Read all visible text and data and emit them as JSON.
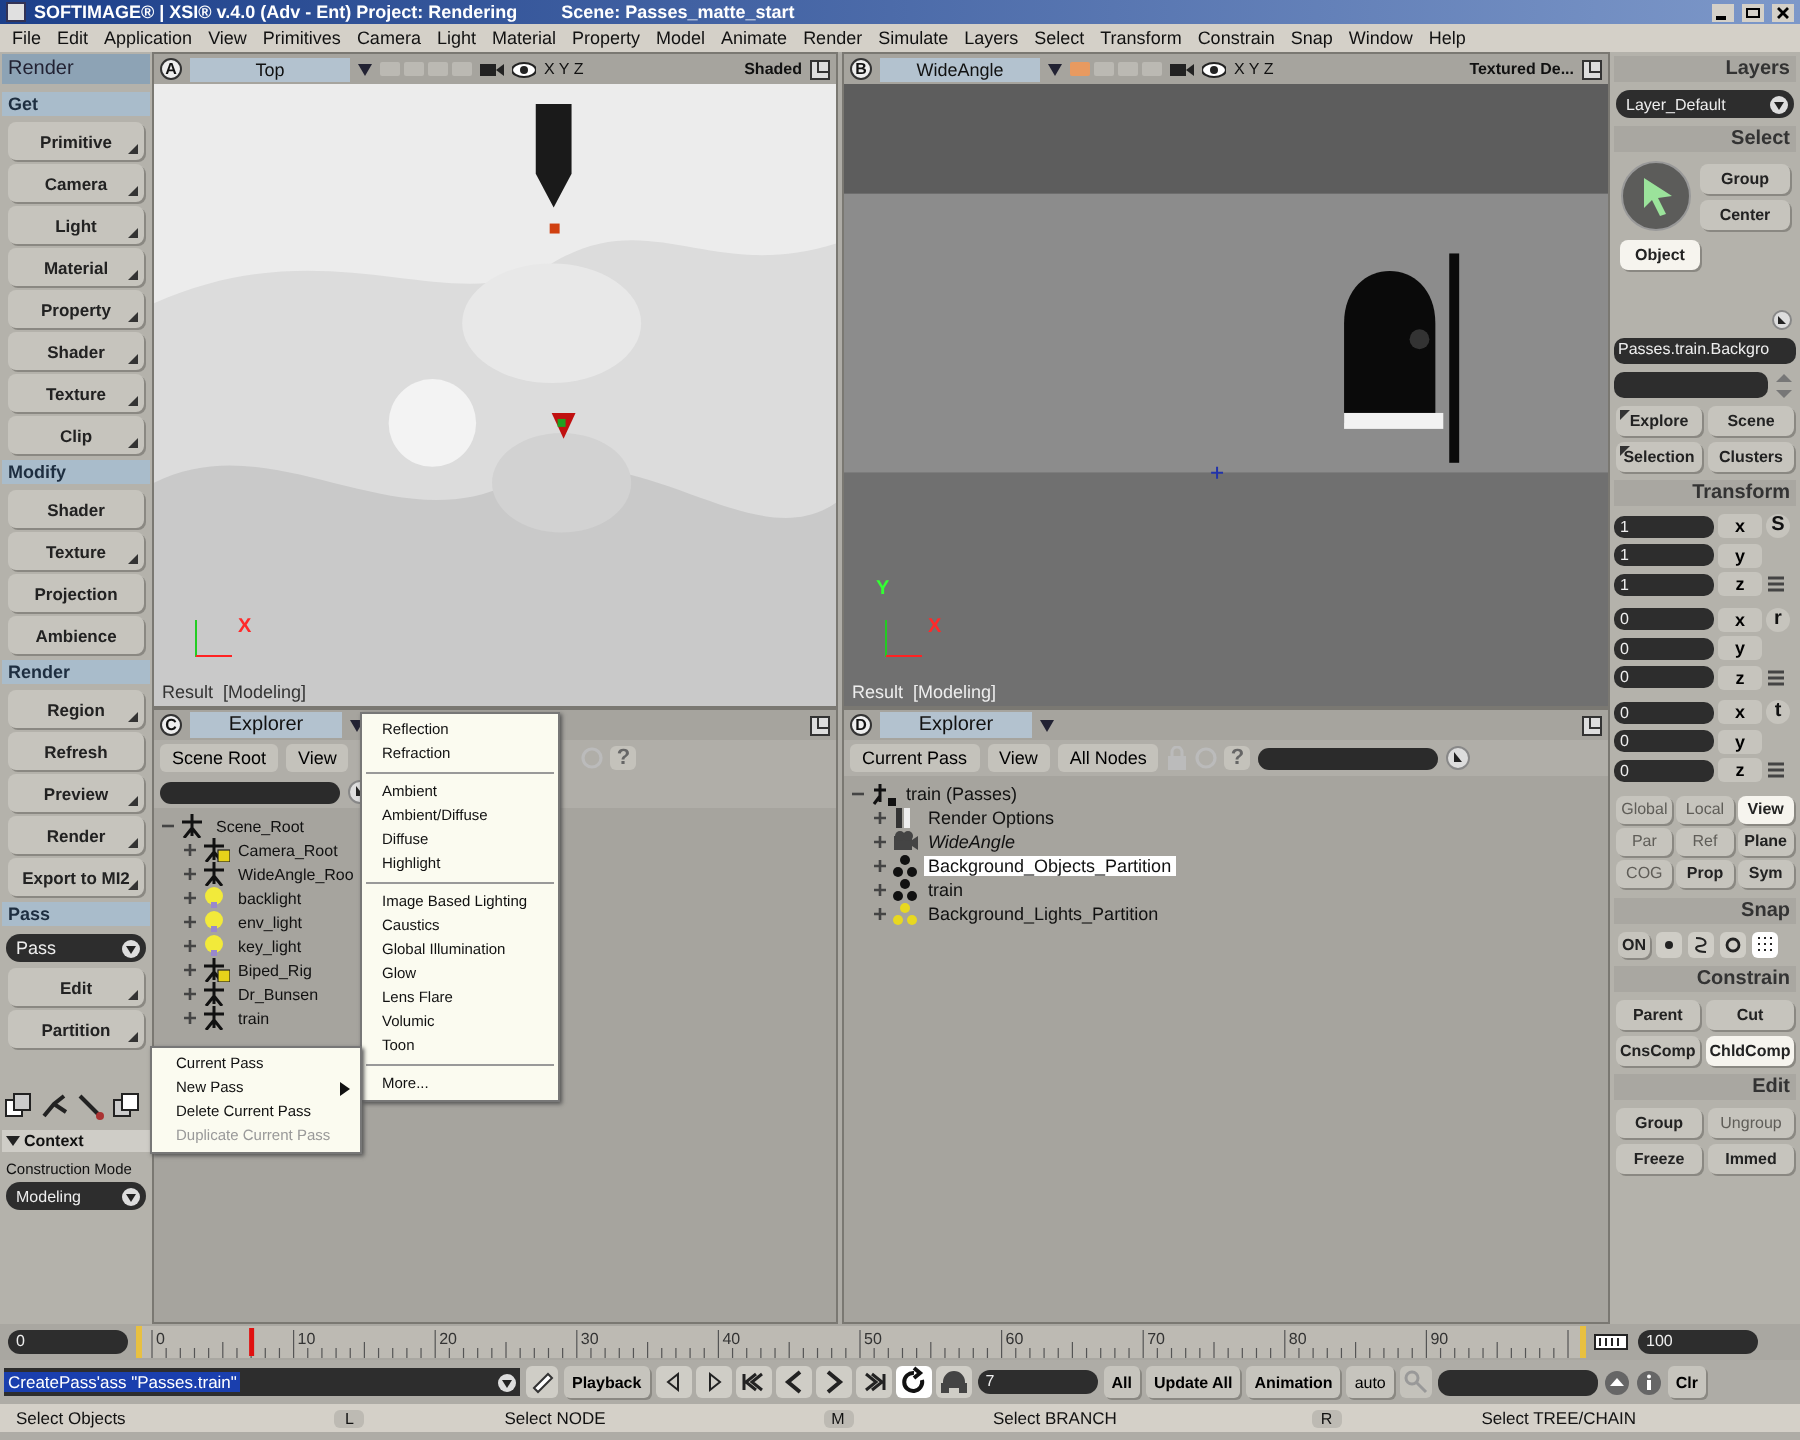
{
  "window": {
    "title": "SOFTIMAGE® | XSI® v.4.0 (Adv - Ent) Project: Rendering",
    "scene": "Scene: Passes_matte_start"
  },
  "menu": [
    "File",
    "Edit",
    "Application",
    "View",
    "Primitives",
    "Camera",
    "Light",
    "Material",
    "Property",
    "Model",
    "Animate",
    "Render",
    "Simulate",
    "Layers",
    "Select",
    "Transform",
    "Constrain",
    "Snap",
    "Window",
    "Help"
  ],
  "left_panel": {
    "title": "Render",
    "sections": [
      {
        "title": "Get",
        "buttons": [
          {
            "label": "Primitive",
            "menu": true
          },
          {
            "label": "Camera",
            "menu": true
          },
          {
            "label": "Light",
            "menu": true
          },
          {
            "label": "Material",
            "menu": true
          },
          {
            "label": "Property",
            "menu": true
          },
          {
            "label": "Shader",
            "menu": true
          },
          {
            "label": "Texture",
            "menu": true
          },
          {
            "label": "Clip",
            "menu": true
          }
        ]
      },
      {
        "title": "Modify",
        "buttons": [
          {
            "label": "Shader",
            "menu": false
          },
          {
            "label": "Texture",
            "menu": true
          },
          {
            "label": "Projection",
            "menu": false
          },
          {
            "label": "Ambience",
            "menu": false
          }
        ]
      },
      {
        "title": "Render",
        "buttons": [
          {
            "label": "Region",
            "menu": true
          },
          {
            "label": "Refresh",
            "menu": false
          },
          {
            "label": "Preview",
            "menu": true
          },
          {
            "label": "Render",
            "menu": true
          },
          {
            "label": "Export to MI2",
            "menu": true
          }
        ]
      },
      {
        "title": "Pass",
        "dropdown": "Pass",
        "buttons": [
          {
            "label": "Edit",
            "menu": true
          },
          {
            "label": "Partition",
            "menu": true
          }
        ]
      }
    ],
    "context": {
      "title": "Context",
      "label": "Construction Mode",
      "mode": "Modeling"
    }
  },
  "viewports": [
    {
      "letter": "A",
      "camera": "Top",
      "axes_text": "X Y Z",
      "shading": "Shaded",
      "kind": "top",
      "axis_labels": [
        "X"
      ],
      "overlay": "Result  [Modeling]"
    },
    {
      "letter": "B",
      "camera": "WideAngle",
      "axes_text": "X Y Z",
      "shading": "Textured De...",
      "kind": "perspective",
      "axis_labels": [
        "Y",
        "X"
      ],
      "overlay": "Result  [Modeling]"
    }
  ],
  "explorers": [
    {
      "letter": "C",
      "title": "Explorer",
      "toolbar": [
        "Scene Root",
        "View"
      ],
      "help": "?",
      "tree": [
        {
          "label": "Scene_Root",
          "kind": "null",
          "expanded": true,
          "children": [
            {
              "label": "Camera_Root",
              "kind": "model",
              "expanded": false
            },
            {
              "label": "WideAngle_Roo",
              "kind": "null",
              "expanded": false
            },
            {
              "label": "backlight",
              "kind": "light",
              "expanded": false
            },
            {
              "label": "env_light",
              "kind": "light",
              "expanded": false
            },
            {
              "label": "key_light",
              "kind": "light",
              "expanded": false
            },
            {
              "label": "Biped_Rig",
              "kind": "model",
              "expanded": false
            },
            {
              "label": "Dr_Bunsen",
              "kind": "null",
              "expanded": false
            },
            {
              "label": "train",
              "kind": "null",
              "expanded": false
            }
          ]
        }
      ]
    },
    {
      "letter": "D",
      "title": "Explorer",
      "toolbar": [
        "Current Pass",
        "View",
        "All Nodes"
      ],
      "help": "?",
      "tree": [
        {
          "label": "train (Passes)",
          "kind": "pass",
          "expanded": true,
          "children": [
            {
              "label": "Render Options",
              "kind": "options",
              "expanded": false,
              "italic": false,
              "selected": false
            },
            {
              "label": "WideAngle",
              "kind": "camera",
              "expanded": false,
              "italic": true,
              "selected": false
            },
            {
              "label": "Background_Objects_Partition",
              "kind": "partition",
              "expanded": false,
              "italic": false,
              "selected": true
            },
            {
              "label": "train",
              "kind": "partition",
              "expanded": false,
              "italic": false,
              "selected": false
            },
            {
              "label": "Background_Lights_Partition",
              "kind": "light-partition",
              "expanded": false,
              "italic": false,
              "selected": false
            }
          ]
        }
      ]
    }
  ],
  "context_menu": [
    {
      "label": "Current Pass",
      "submenu": false,
      "disabled": false
    },
    {
      "label": "New Pass",
      "submenu": true,
      "disabled": false
    },
    {
      "label": "Delete Current Pass",
      "submenu": false,
      "disabled": false
    },
    {
      "label": "Duplicate Current Pass",
      "submenu": false,
      "disabled": true
    }
  ],
  "submenu": [
    [
      "Reflection",
      "Refraction"
    ],
    [
      "Ambient",
      "Ambient/Diffuse",
      "Diffuse",
      "Highlight"
    ],
    [
      "Image Based Lighting",
      "Caustics",
      "Global Illumination",
      "Glow",
      "Lens Flare",
      "Volumic",
      "Toon"
    ],
    [
      "More..."
    ]
  ],
  "right_panel": {
    "layers": {
      "title": "Layers",
      "dropdown": "Layer_Default"
    },
    "select": {
      "title": "Select",
      "buttons": [
        "Group",
        "Center"
      ],
      "object": {
        "label": "Object",
        "selected": true
      },
      "field": "Passes.train.Backgro",
      "more": [
        {
          "label": "Explore",
          "menu": true
        },
        {
          "label": "Scene",
          "menu": false
        },
        {
          "label": "Selection",
          "menu": true
        },
        {
          "label": "Clusters",
          "menu": false
        }
      ]
    },
    "transform": {
      "title": "Transform",
      "groups": [
        {
          "key": "S",
          "rows": [
            {
              "value": "1",
              "axis": "x"
            },
            {
              "value": "1",
              "axis": "y"
            },
            {
              "value": "1",
              "axis": "z"
            }
          ]
        },
        {
          "key": "r",
          "rows": [
            {
              "value": "0",
              "axis": "x"
            },
            {
              "value": "0",
              "axis": "y"
            },
            {
              "value": "0",
              "axis": "z"
            }
          ]
        },
        {
          "key": "t",
          "rows": [
            {
              "value": "0",
              "axis": "x"
            },
            {
              "value": "0",
              "axis": "y"
            },
            {
              "value": "0",
              "axis": "z"
            }
          ]
        }
      ],
      "modes": [
        {
          "label": "Global",
          "selected": false,
          "disabled": true
        },
        {
          "label": "Local",
          "selected": false,
          "disabled": true
        },
        {
          "label": "View",
          "selected": true,
          "disabled": false
        },
        {
          "label": "Par",
          "selected": false,
          "disabled": true
        },
        {
          "label": "Ref",
          "selected": false,
          "disabled": true
        },
        {
          "label": "Plane",
          "selected": false,
          "disabled": false
        },
        {
          "label": "COG",
          "selected": false,
          "disabled": true
        },
        {
          "label": "Prop",
          "selected": false,
          "disabled": false
        },
        {
          "label": "Sym",
          "selected": false,
          "disabled": false
        }
      ]
    },
    "snap": {
      "title": "Snap",
      "on": "ON"
    },
    "constrain": {
      "title": "Constrain",
      "buttons": [
        {
          "label": "Parent",
          "selected": false,
          "disabled": false
        },
        {
          "label": "Cut",
          "selected": false,
          "disabled": false
        },
        {
          "label": "CnsComp",
          "selected": false,
          "disabled": false
        },
        {
          "label": "ChldComp",
          "selected": true,
          "disabled": false
        }
      ]
    },
    "edit": {
      "title": "Edit",
      "buttons": [
        {
          "label": "Group",
          "selected": false,
          "disabled": false
        },
        {
          "label": "Ungroup",
          "selected": false,
          "disabled": true
        },
        {
          "label": "Freeze",
          "selected": false,
          "disabled": false
        },
        {
          "label": "Immed",
          "selected": false,
          "disabled": false
        }
      ]
    }
  },
  "timeline": {
    "start": "0",
    "end": "100",
    "ticks": [
      "0",
      "10",
      "20",
      "30",
      "40",
      "50",
      "60",
      "70",
      "80",
      "90"
    ],
    "playhead": {
      "level": 0.07
    }
  },
  "command": {
    "text": "CreatePass'ass \"Passes.train\"",
    "playback": "Playback",
    "transport": [
      {
        "kind": "prev-key"
      },
      {
        "kind": "next-key"
      },
      {
        "kind": "first"
      },
      {
        "kind": "prev"
      },
      {
        "kind": "next"
      },
      {
        "kind": "last"
      },
      {
        "kind": "loop"
      },
      {
        "kind": "audio"
      }
    ],
    "frame": "7",
    "all": "All",
    "update": "Update All",
    "animation": "Animation",
    "auto": "auto",
    "clear": "Clr"
  },
  "status": [
    {
      "text": "Select Objects"
    },
    {
      "key": "L",
      "text": "Select NODE"
    },
    {
      "key": "M",
      "text": "Select BRANCH"
    },
    {
      "key": "R",
      "text": "Select TREE/CHAIN"
    }
  ]
}
